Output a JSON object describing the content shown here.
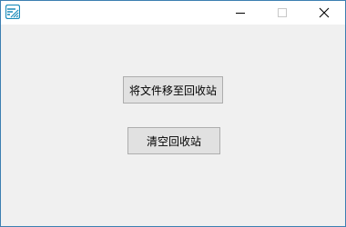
{
  "window": {
    "title": "",
    "app_icon": "app-icon"
  },
  "caption_buttons": {
    "minimize_icon": "minimize-icon",
    "maximize_icon": "maximize-icon",
    "close_icon": "close-icon"
  },
  "buttons": {
    "move_to_recycle_bin": "将文件移至回收站",
    "empty_recycle_bin": "清空回收站"
  },
  "colors": {
    "accent": "#1c8cba",
    "window_border": "#3c7fb1",
    "client_background": "#f0f0f0",
    "button_face": "#e1e1e1",
    "button_border": "#adadad"
  }
}
